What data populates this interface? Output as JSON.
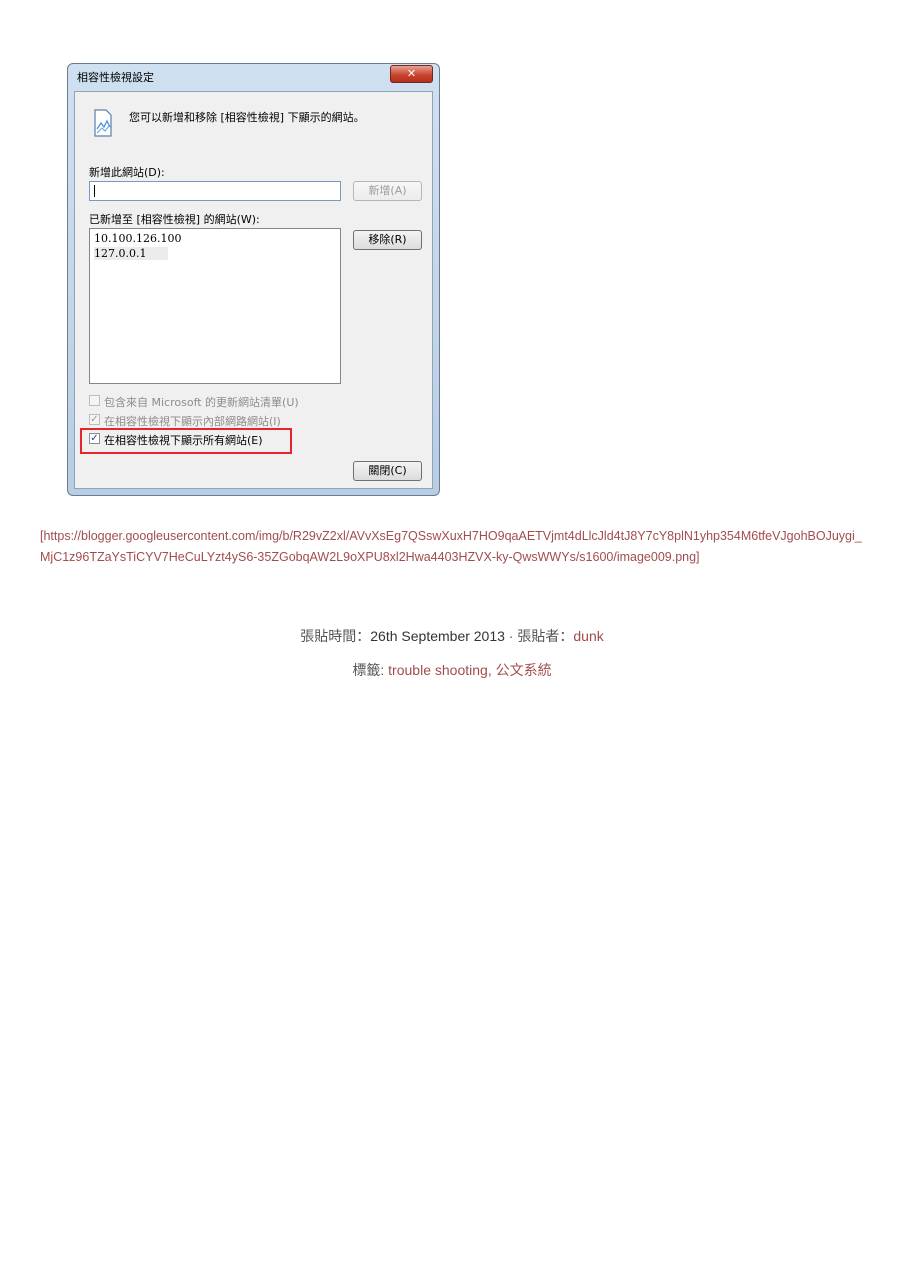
{
  "dialog": {
    "title": "相容性檢視設定",
    "close_glyph": "✕",
    "info_text": "您可以新增和移除 [相容性檢視] 下顯示的網站。",
    "add_site_label": "新增此網站(D):",
    "add_site_value": "",
    "add_button": "新增(A)",
    "added_sites_label": "已新增至 [相容性檢視] 的網站(W):",
    "sites": [
      "10.100.126.100",
      "127.0.0.1"
    ],
    "remove_button": "移除(R)",
    "checkboxes": [
      {
        "label": "包含來自 Microsoft 的更新網站清單(U)",
        "checked": false,
        "enabled": false
      },
      {
        "label": "在相容性檢視下顯示內部網路網站(I)",
        "checked": true,
        "enabled": false
      },
      {
        "label": "在相容性檢視下顯示所有網站(E)",
        "checked": true,
        "enabled": true
      }
    ],
    "close_button": "關閉(C)"
  },
  "image_link": "[https://blogger.googleusercontent.com/img/b/R29vZ2xl/AVvXsEg7QSswXuxH7HO9qaAETVjmt4dLlcJld4tJ8Y7cY8plN1yhp354M6tfeVJgohBOJuygi_MjC1z96TZaYsTiCYV7HeCuLYzt4yS6-35ZGobqAW2L9oXPU8xl2Hwa4403HZVX-ky-QwsWWYs/s1600/image009.png]",
  "post_meta": {
    "posted_label": "張貼時間：",
    "date": "26th September 2013",
    "separator": " · ",
    "author_label": "張貼者：",
    "author": "dunk",
    "labels_label": "標籤: ",
    "labels": [
      "trouble shooting",
      "公文系統"
    ]
  },
  "colors": {
    "link": "#a24d4d",
    "highlight": "#e4262c"
  }
}
